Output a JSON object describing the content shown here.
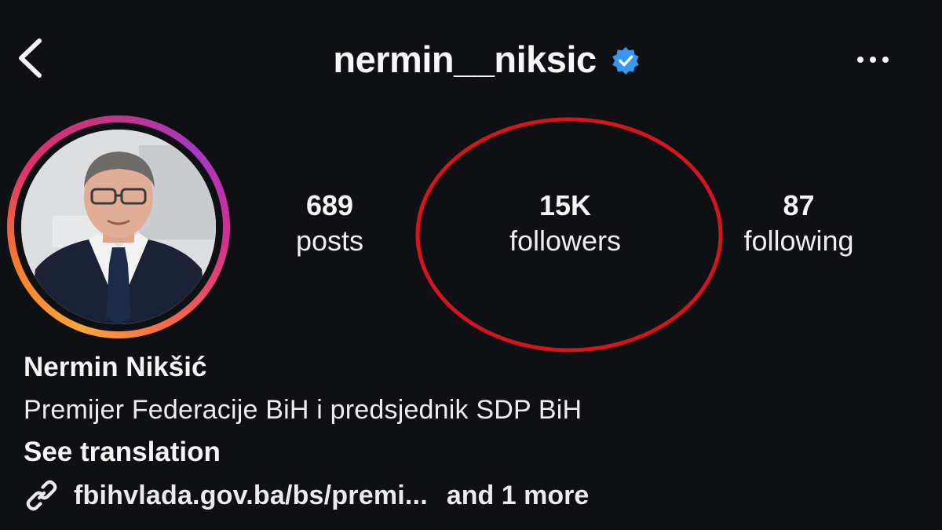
{
  "header": {
    "username": "nermin__niksic",
    "verified": true,
    "back_icon": "chevron-left-icon",
    "more_icon": "ellipsis-horizontal-icon"
  },
  "stats": {
    "posts": {
      "value": "689",
      "label": "posts"
    },
    "followers": {
      "value": "15K",
      "label": "followers"
    },
    "following": {
      "value": "87",
      "label": "following"
    }
  },
  "profile": {
    "full_name": "Nermin Nikšić",
    "bio": "Premijer Federacije BiH i predsjednik SDP BiH",
    "see_translation": "See translation",
    "link_text": "fbihvlada.gov.ba/bs/premi...",
    "link_more": "and 1 more"
  },
  "colors": {
    "background": "#0f1013",
    "verified_badge": "#3897f0",
    "highlight_circle": "#d2161c",
    "story_ring": [
      "#f9a63a",
      "#e1306c",
      "#a63ac4"
    ]
  }
}
